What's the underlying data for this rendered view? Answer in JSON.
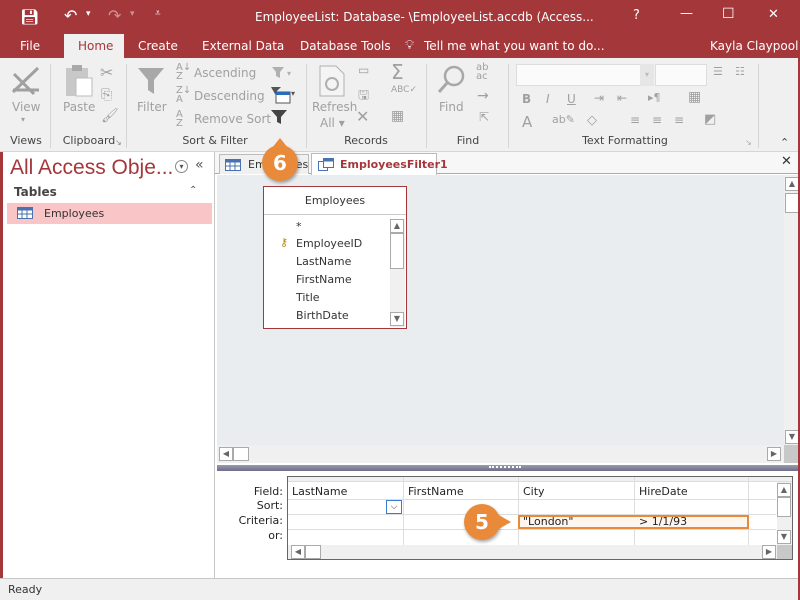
{
  "window": {
    "title": "EmployeeList: Database- \\EmployeeList.accdb (Access...",
    "help": "?",
    "minimize": "—",
    "maximize": "☐",
    "close": "✕"
  },
  "qat": {
    "save": "save-icon",
    "undo": "↶",
    "redo": "↷",
    "dropdown": "▾",
    "customize": "⩡"
  },
  "ribbon_tabs": [
    {
      "label": "File"
    },
    {
      "label": "Home"
    },
    {
      "label": "Create"
    },
    {
      "label": "External Data"
    },
    {
      "label": "Database Tools"
    }
  ],
  "tell_me": "Tell me what you want to do...",
  "user": "Kayla Claypool",
  "groups": {
    "views": {
      "label": "Views",
      "view": "View"
    },
    "clipboard": {
      "label": "Clipboard",
      "paste": "Paste"
    },
    "sort_filter": {
      "label": "Sort & Filter",
      "filter": "Filter",
      "ascending": "Ascending",
      "descending": "Descending",
      "remove_sort": "Remove Sort"
    },
    "records": {
      "label": "Records",
      "refresh": "Refresh",
      "all": "All ▾"
    },
    "find": {
      "label": "Find",
      "find": "Find"
    },
    "text_formatting": {
      "label": "Text Formatting",
      "bold": "B",
      "italic": "I",
      "underline": "U"
    }
  },
  "nav_pane": {
    "title": "All Access Obje...",
    "section": "Tables",
    "items": [
      {
        "label": "Employees",
        "selected": true
      }
    ]
  },
  "doc_tabs": [
    {
      "label": "Employees"
    },
    {
      "label": "EmployeesFilter1",
      "active": true
    }
  ],
  "field_list": {
    "title": "Employees",
    "fields": [
      "*",
      "EmployeeID",
      "LastName",
      "FirstName",
      "Title",
      "BirthDate"
    ]
  },
  "grid": {
    "row_labels": [
      "Field:",
      "Sort:",
      "Criteria:",
      "or:"
    ],
    "columns": [
      {
        "field": "LastName",
        "sort": "",
        "criteria": "",
        "or": ""
      },
      {
        "field": "FirstName",
        "sort": "",
        "criteria": "",
        "or": ""
      },
      {
        "field": "City",
        "sort": "",
        "criteria": "\"London\"",
        "or": ""
      },
      {
        "field": "HireDate",
        "sort": "",
        "criteria": "> 1/1/93",
        "or": ""
      },
      {
        "field": "",
        "sort": "",
        "criteria": "",
        "or": ""
      }
    ]
  },
  "callouts": {
    "step5": "5",
    "step6": "6"
  },
  "status": "Ready",
  "colors": {
    "brand": "#a4373a",
    "callout": "#e9893a",
    "selected_nav": "#f9c5c6"
  }
}
